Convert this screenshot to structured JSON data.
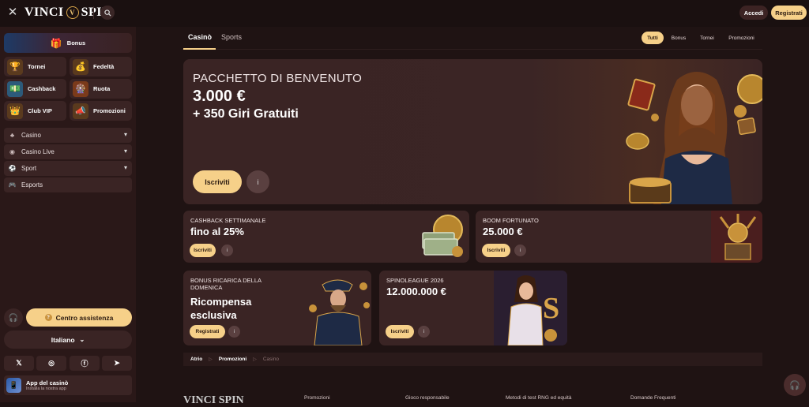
{
  "header": {
    "logo_left": "VINCI",
    "logo_right": "SPIN",
    "login_label": "Accedi",
    "register_label": "Registrati"
  },
  "sidebar": {
    "bonus_label": "Bonus",
    "tiles": [
      {
        "label": "Tornei",
        "icon": "trophy-icon"
      },
      {
        "label": "Fedeltà",
        "icon": "treasure-chest-icon"
      },
      {
        "label": "Cashback",
        "icon": "cashback-icon"
      },
      {
        "label": "Ruota",
        "icon": "wheel-icon"
      },
      {
        "label": "Club VIP",
        "icon": "crown-icon"
      },
      {
        "label": "Promozioni",
        "icon": "megaphone-icon"
      }
    ],
    "nav": [
      {
        "label": "Casino",
        "icon": "cherries-icon",
        "expandable": true
      },
      {
        "label": "Casino Live",
        "icon": "broadcast-icon",
        "expandable": true
      },
      {
        "label": "Sport",
        "icon": "soccer-ball-icon",
        "expandable": true
      },
      {
        "label": "Esports",
        "icon": "gamepad-icon",
        "expandable": false
      }
    ],
    "help_label": "Centro assistenza",
    "language": "Italiano",
    "socials": [
      "X",
      "Instagram",
      "Facebook",
      "Telegram"
    ],
    "app_title": "App del casinò",
    "app_subtitle": "Installa la nostra app"
  },
  "main": {
    "tabs": [
      "Casinò",
      "Sports"
    ],
    "active_tab": "Casinò",
    "filters": [
      "Tutti",
      "Bonus",
      "Tornei",
      "Promozioni"
    ],
    "active_filter": "Tutti",
    "hero": {
      "subtitle": "PACCHETTO DI BENVENUTO",
      "amount": "3.000 €",
      "extra": "+ 350 Giri Gratuiti",
      "cta": "Iscriviti"
    },
    "cards": [
      {
        "subtitle": "CASHBACK SETTIMANALE",
        "title": "fino al 25%",
        "cta": "Iscriviti"
      },
      {
        "subtitle": "BOOM FORTUNATO",
        "title": "25.000 €",
        "cta": "Iscriviti"
      },
      {
        "subtitle": "BONUS RICARICA DELLA DOMENICA",
        "title": "Ricompensa esclusiva",
        "cta": "Registrati"
      },
      {
        "subtitle": "SPINOLEAGUE 2026",
        "title": "12.000.000 €",
        "cta": "Iscriviti"
      }
    ],
    "breadcrumb": [
      "Atrio",
      "Promozioni",
      "Casino"
    ]
  },
  "footer": {
    "logo": "VINCI SPIN",
    "links": [
      "Promozioni",
      "Gioco responsabile",
      "Metodi di test RNG ed equità",
      "Domande Frequenti"
    ]
  },
  "colors": {
    "accent": "#f6d089",
    "background": "#1f1313",
    "panel": "#3a2424"
  }
}
